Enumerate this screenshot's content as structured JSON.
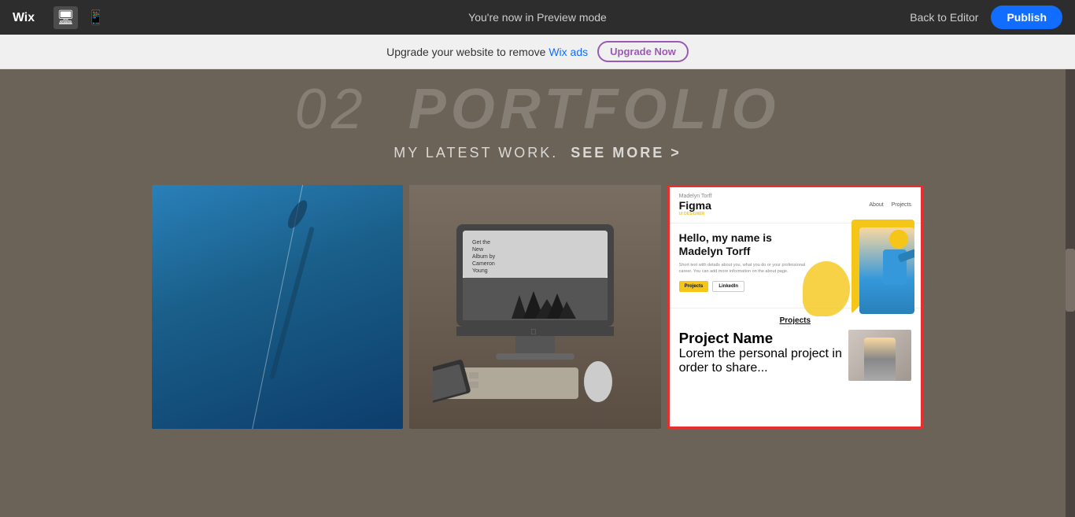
{
  "topbar": {
    "preview_text": "You're now in Preview mode",
    "back_label": "Back to Editor",
    "publish_label": "Publish",
    "device_desktop_icon": "🖥",
    "device_mobile_icon": "📱"
  },
  "banner": {
    "text": "Upgrade your website to remove Wix ads",
    "wix_ads_text": "Wix ads",
    "button_label": "Upgrade Now"
  },
  "portfolio": {
    "number": "02",
    "title": "PORTFOLIO",
    "subtitle": "MY LATEST WORK.",
    "see_more": "SEE MORE >",
    "cards": [
      {
        "id": "deep",
        "label": "deep"
      },
      {
        "id": "mac",
        "label": "mac setup"
      },
      {
        "id": "figma",
        "label": "figma project"
      }
    ]
  },
  "figma_card": {
    "nav_name": "Madelyn Torff",
    "logo": "Figma",
    "nav_links": [
      "About",
      "Projects"
    ],
    "heading": "Hello, my name is Madelyn Torff",
    "description": "Short text with details about you, what you do or your professional career. You can add more information on the about page.",
    "btn1": "Projects",
    "btn2": "LinkedIn",
    "projects_title": "Projects",
    "project_name": "Project Name",
    "project_desc": "Lorem the personal project in order to share..."
  }
}
